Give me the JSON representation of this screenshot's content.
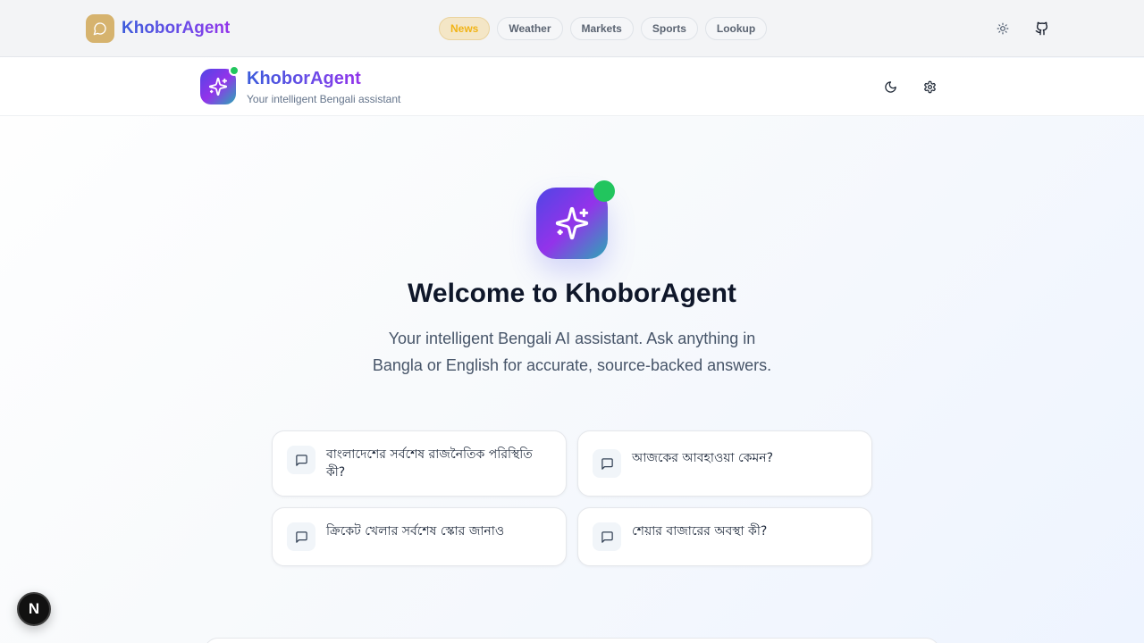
{
  "topbar": {
    "brand": "KhoborAgent",
    "tabs": [
      {
        "label": "News",
        "active": true
      },
      {
        "label": "Weather",
        "active": false
      },
      {
        "label": "Markets",
        "active": false
      },
      {
        "label": "Sports",
        "active": false
      },
      {
        "label": "Lookup",
        "active": false
      }
    ],
    "icons": [
      "sun-icon",
      "github-icon"
    ]
  },
  "header": {
    "title": "KhoborAgent",
    "subtitle": "Your intelligent Bengali assistant",
    "icons": [
      "moon-icon",
      "gear-icon"
    ]
  },
  "welcome": {
    "title": "Welcome to KhoborAgent",
    "description": "Your intelligent Bengali AI assistant. Ask anything in Bangla or English for accurate, source-backed answers."
  },
  "suggestions": [
    {
      "text": "বাংলাদেশের সর্বশেষ রাজনৈতিক পরিস্থিতি কী?"
    },
    {
      "text": "আজকের আবহাওয়া কেমন?"
    },
    {
      "text": "ক্রিকেট খেলার সর্বশেষ স্কোর জানাও"
    },
    {
      "text": "শেয়ার বাজারের অবস্থা কী?"
    }
  ],
  "dev_badge": {
    "label": "N"
  },
  "colors": {
    "brand_gradient": [
      "#3b5bdb",
      "#9333ea"
    ],
    "active_tab_bg": "#f4e6c6",
    "active_tab_text": "#f1b417",
    "online": "#22c55e"
  }
}
